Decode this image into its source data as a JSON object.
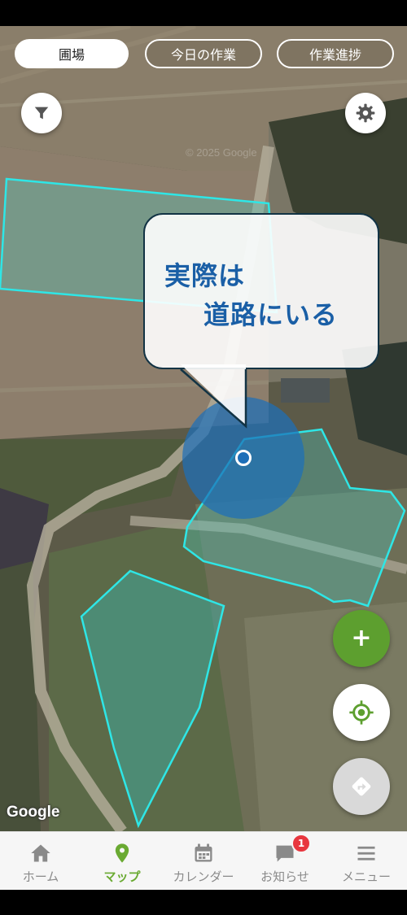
{
  "tabs": [
    {
      "label": "圃場",
      "active": true
    },
    {
      "label": "今日の作業",
      "active": false
    },
    {
      "label": "作業進捗",
      "active": false
    }
  ],
  "map": {
    "copyright": "© 2025 Google",
    "google_logo": "Google",
    "field_outline_color": "#2ee6e6",
    "location_color": "#1d6fb8"
  },
  "callout": {
    "line1": "実際は",
    "line2": "道路にいる"
  },
  "controls": {
    "filter": "filter-icon",
    "settings": "gear-icon",
    "add": "+",
    "add_color": "#5d9f2f",
    "locate": "crosshair-icon",
    "navigate": "direction-icon"
  },
  "bottom_nav": [
    {
      "label": "ホーム",
      "icon": "home-icon",
      "active": false
    },
    {
      "label": "マップ",
      "icon": "map-pin-icon",
      "active": true
    },
    {
      "label": "カレンダー",
      "icon": "calendar-icon",
      "active": false
    },
    {
      "label": "お知らせ",
      "icon": "chat-icon",
      "active": false,
      "badge": "1"
    },
    {
      "label": "メニュー",
      "icon": "menu-icon",
      "active": false
    }
  ],
  "accent_color": "#6aaa32"
}
